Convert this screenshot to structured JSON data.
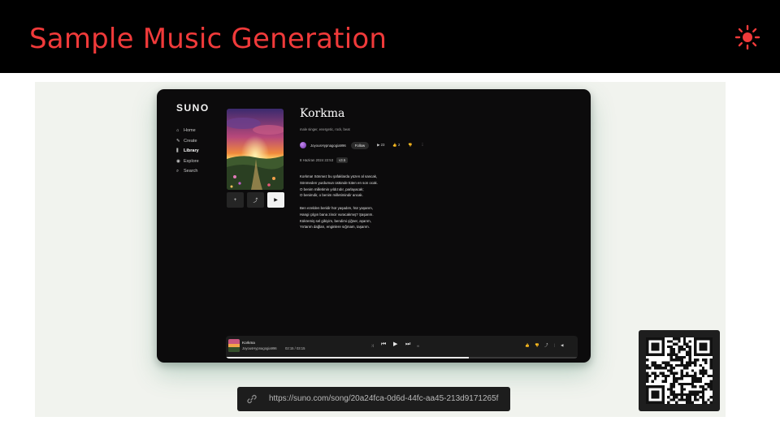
{
  "slide": {
    "title": "Sample Music Generation",
    "accent_color": "#f03a3a",
    "theme_icon": "sun-icon"
  },
  "app": {
    "logo": "SUNO",
    "nav": [
      {
        "icon": "home-icon",
        "glyph": "⌂",
        "label": "Home"
      },
      {
        "icon": "create-icon",
        "glyph": "✎",
        "label": "Create"
      },
      {
        "icon": "library-icon",
        "glyph": "⫼",
        "label": "Library"
      },
      {
        "icon": "explore-icon",
        "glyph": "◉",
        "label": "Explore"
      },
      {
        "icon": "search-icon",
        "glyph": "⌕",
        "label": "Search"
      }
    ],
    "active_nav": "Library"
  },
  "song": {
    "title": "Korkma",
    "tags": "male singer, energetic, rock, beat",
    "author": "JoyousHypnagogia996",
    "follow_label": "Follow",
    "plays": "▶ 23",
    "likes": "👍 2",
    "date": "8 Haziran 2024 22:53",
    "version": "v3.5",
    "cover_buttons": [
      {
        "name": "add-button",
        "glyph": "+"
      },
      {
        "name": "share-button",
        "glyph": "⤴"
      },
      {
        "name": "play-button",
        "glyph": "▶"
      }
    ],
    "lyrics": "Korkma! Sönmez bu şafaklarda yüzen al sancak,\nSönmeden yurdumun üstünde tüten en son ocak.\nO benim milletimin yıldızıdır, parlayacak;\nO benimdir, o benim milletimindir ancak.\n\nBen ezelden beridir hür yaşadım, hür yaşarım,\nHangi çılgın bana zincir vuracakmış? Şaşarım.\nKükremiş sel gibiyim, bendimi çiğner, aşarım,\nYırtarım dağları, enginlere sığmam, taşarım."
  },
  "player": {
    "title": "Korkma",
    "artist": "JoyousHypnagogia996",
    "time": "02:15 / 03:15",
    "progress": 0.69,
    "controls": [
      "shuffle-icon",
      "previous-icon",
      "play-icon",
      "next-icon",
      "repeat-icon"
    ],
    "right_controls": [
      "like-icon",
      "dislike-icon",
      "share-icon",
      "volume-icon"
    ]
  },
  "url": {
    "text": "https://suno.com/song/20a24fca-0d6d-44fc-aa45-213d9171265f",
    "icon": "link-icon"
  },
  "qr": {
    "icon": "qr-code-icon"
  }
}
